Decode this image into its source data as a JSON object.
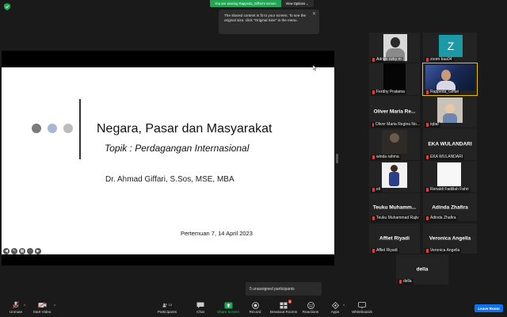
{
  "top": {
    "viewing_text": "You are viewing Rappeda_Giffari's screen",
    "view_options": "View Options",
    "tooltip": "The shared content is fit to your screen. To see the original size, click \"Original Size\" in the menu."
  },
  "slide": {
    "title": "Negara, Pasar dan Masyarakat",
    "subtitle": "Topik : Perdagangan Internasional",
    "author": "Dr. Ahmad Giffari, S.Sos, MSE, MBA",
    "meeting": "Pertemuan 7, 14 April 2023",
    "dot_colors": [
      "#7a7a7a",
      "#a6b8d6",
      "#bcbcbc"
    ]
  },
  "participants": [
    {
      "name": "Adrian rizky m",
      "label": ""
    },
    {
      "name": "zoom baa04",
      "label": ""
    },
    {
      "name": "Ferdhy Pratama",
      "label": ""
    },
    {
      "name": "Rappeda_Giffari",
      "label": ""
    },
    {
      "name": "Oliver Maria Regina No...",
      "label": "Oliver Maria Re..."
    },
    {
      "name": "iqbal",
      "label": ""
    },
    {
      "name": "winda rahma",
      "label": ""
    },
    {
      "name": "EKA WULANDARI",
      "label": "EKA WULANDARI"
    },
    {
      "name": "eli",
      "label": ""
    },
    {
      "name": "Renaldi Fadillah Fahri",
      "label": ""
    },
    {
      "name": "Teuku Muhammad Rajiv",
      "label": "Teuku Muhamm..."
    },
    {
      "name": "Adinda Zhafira",
      "label": "Adinda Zhafira"
    },
    {
      "name": "Affiet Riyadi",
      "label": "Affiet Riyadi"
    },
    {
      "name": "Veronica Angella",
      "label": "Veronica Angella"
    },
    {
      "name": "della",
      "label": "della"
    }
  ],
  "zoom_avatar_letter": "Z",
  "unassigned": "5 unassigned participants",
  "toolbar": {
    "unmute": "Unmute",
    "start_video": "Start Video",
    "participants": "Participants",
    "participants_count": "15",
    "chat": "Chat",
    "share_screen": "Share Screen",
    "record": "Record",
    "breakout": "Breakout Rooms",
    "breakout_badge": "5",
    "reactions": "Reactions",
    "apps": "Apps",
    "whiteboards": "Whiteboards",
    "leave": "Leave Room"
  }
}
